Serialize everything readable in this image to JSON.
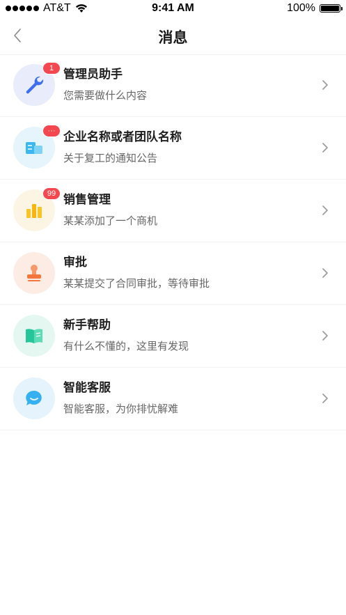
{
  "status": {
    "carrier": "AT&T",
    "time": "9:41 AM",
    "battery": "100%"
  },
  "nav": {
    "title": "消息"
  },
  "items": [
    {
      "title": "管理员助手",
      "subtitle": "您需要做什么内容",
      "badge": "1",
      "icon": "wrench-icon",
      "color": "#3d6ff0",
      "bg": "#e8ecfb"
    },
    {
      "title": "企业名称或者团队名称",
      "subtitle": "关于复工的通知公告",
      "badge": "···",
      "icon": "building-icon",
      "color": "#39b7ef",
      "bg": "#e6f4fc"
    },
    {
      "title": "销售管理",
      "subtitle": "某某添加了一个商机",
      "badge": "99",
      "icon": "bar-chart-icon",
      "color": "#f7b90f",
      "bg": "#fdf5e3"
    },
    {
      "title": "审批",
      "subtitle": "某某提交了合同审批，等待审批",
      "badge": "",
      "icon": "stamp-icon",
      "color": "#f57a45",
      "bg": "#fdece4"
    },
    {
      "title": "新手帮助",
      "subtitle": "有什么不懂的，这里有发现",
      "badge": "",
      "icon": "book-icon",
      "color": "#25c69a",
      "bg": "#e4f8f1"
    },
    {
      "title": "智能客服",
      "subtitle": "智能客服，为你排忧解难",
      "badge": "",
      "icon": "chat-bubble-icon",
      "color": "#35b0f0",
      "bg": "#e4f3fc"
    }
  ]
}
